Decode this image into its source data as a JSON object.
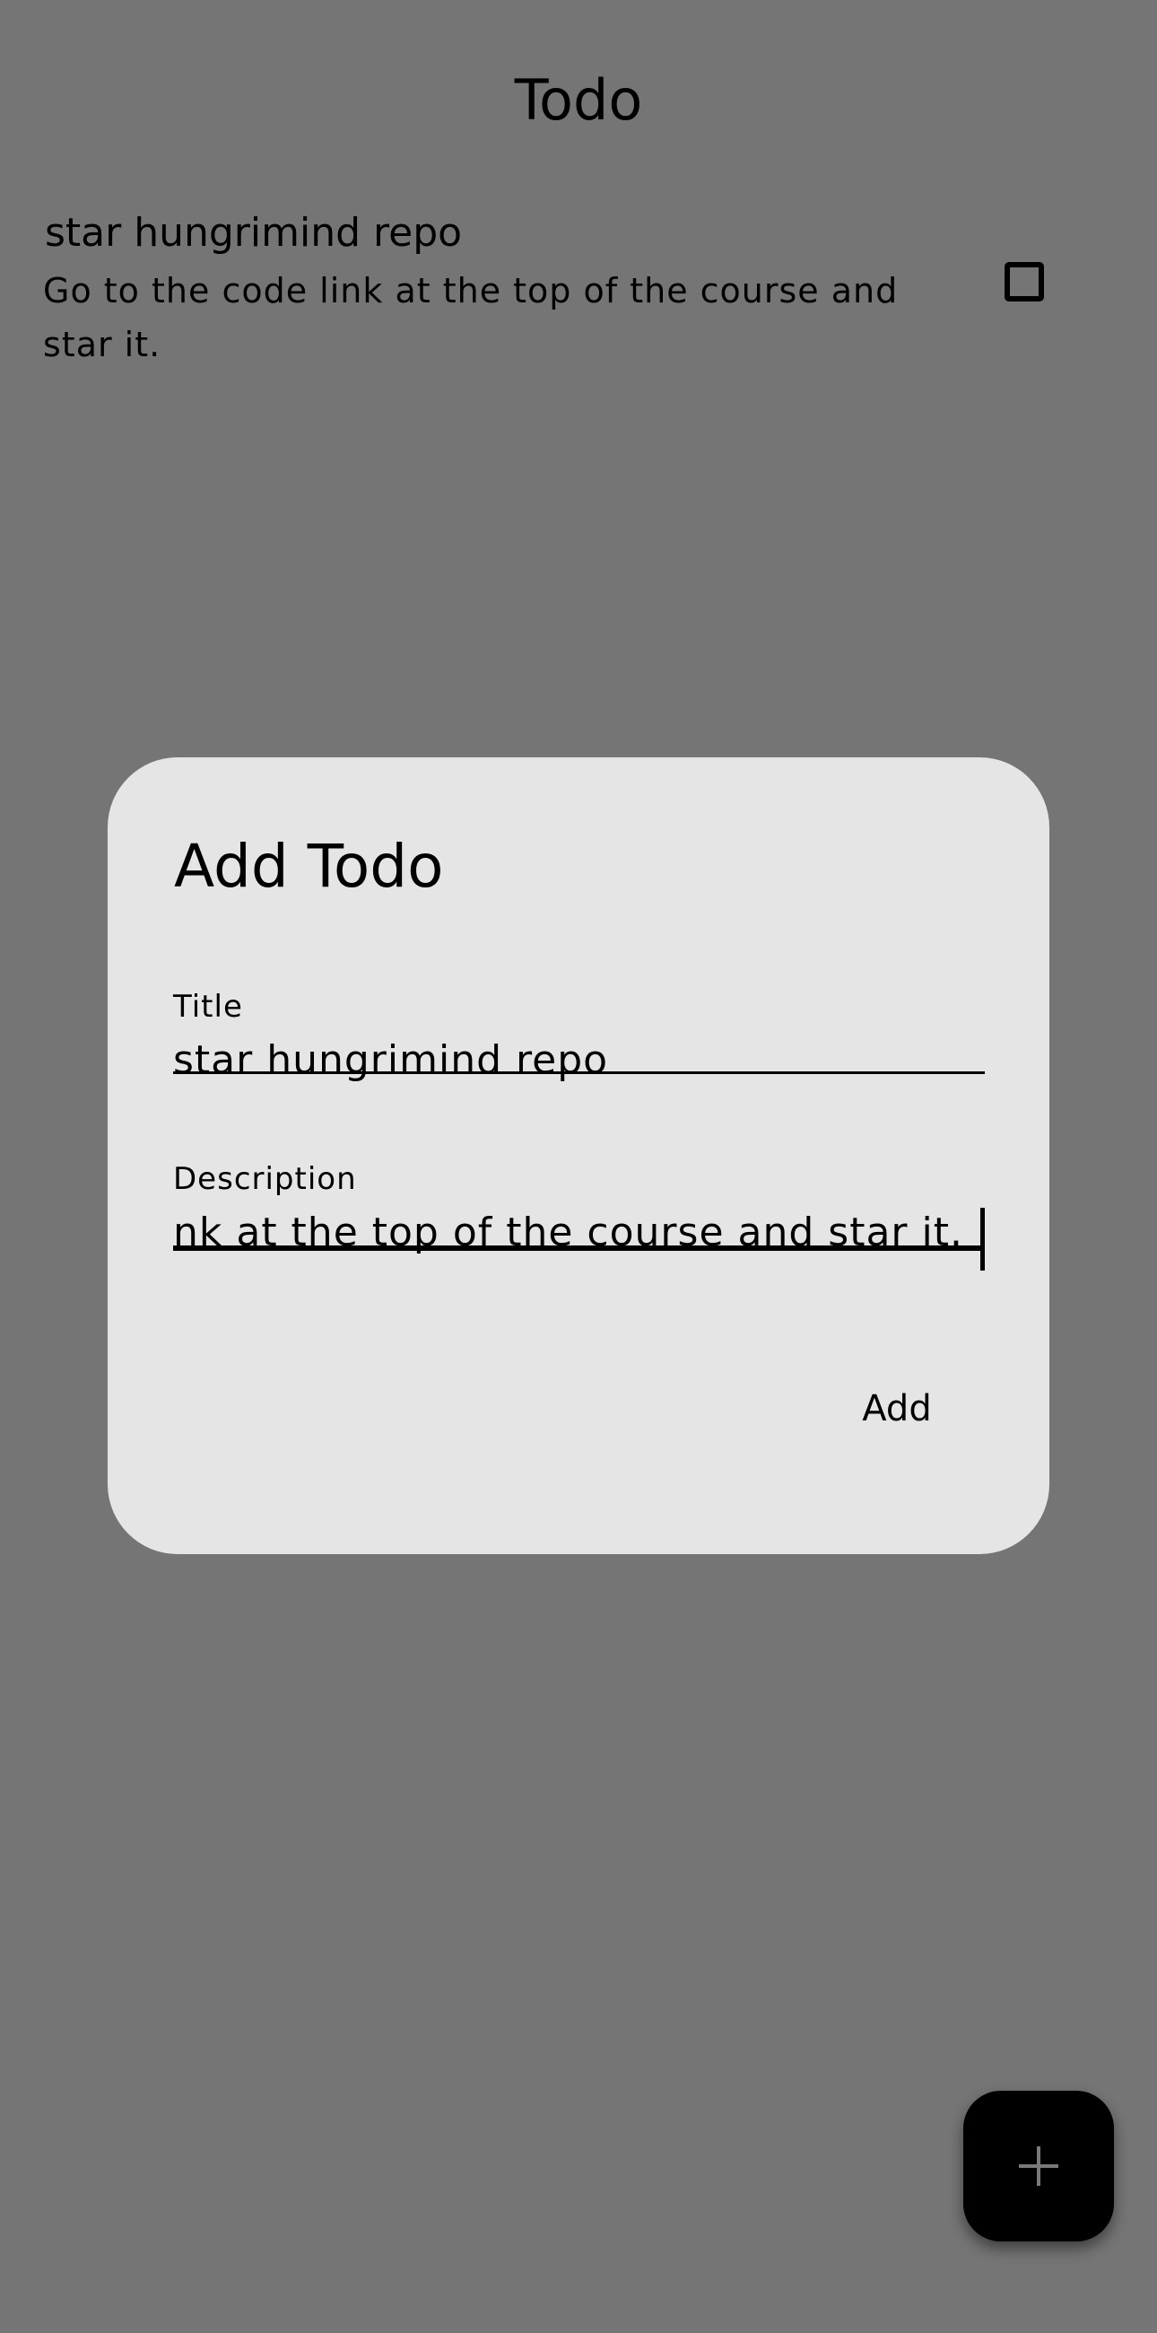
{
  "app": {
    "title": "Todo"
  },
  "todos": [
    {
      "title": "star hungrimind repo",
      "description": "Go to the code link at the top of the course and star it.",
      "checked": false
    }
  ],
  "dialog": {
    "title": "Add Todo",
    "title_field": {
      "label": "Title",
      "value": "star hungrimind repo"
    },
    "description_field": {
      "label": "Description",
      "value": "nk at the top of the course and star it."
    },
    "add_label": "Add"
  },
  "fab": {
    "icon": "plus-icon"
  },
  "colors": {
    "scrim_background": "#757575",
    "dialog_background": "#e5e5e5",
    "fab_background": "#000000"
  }
}
